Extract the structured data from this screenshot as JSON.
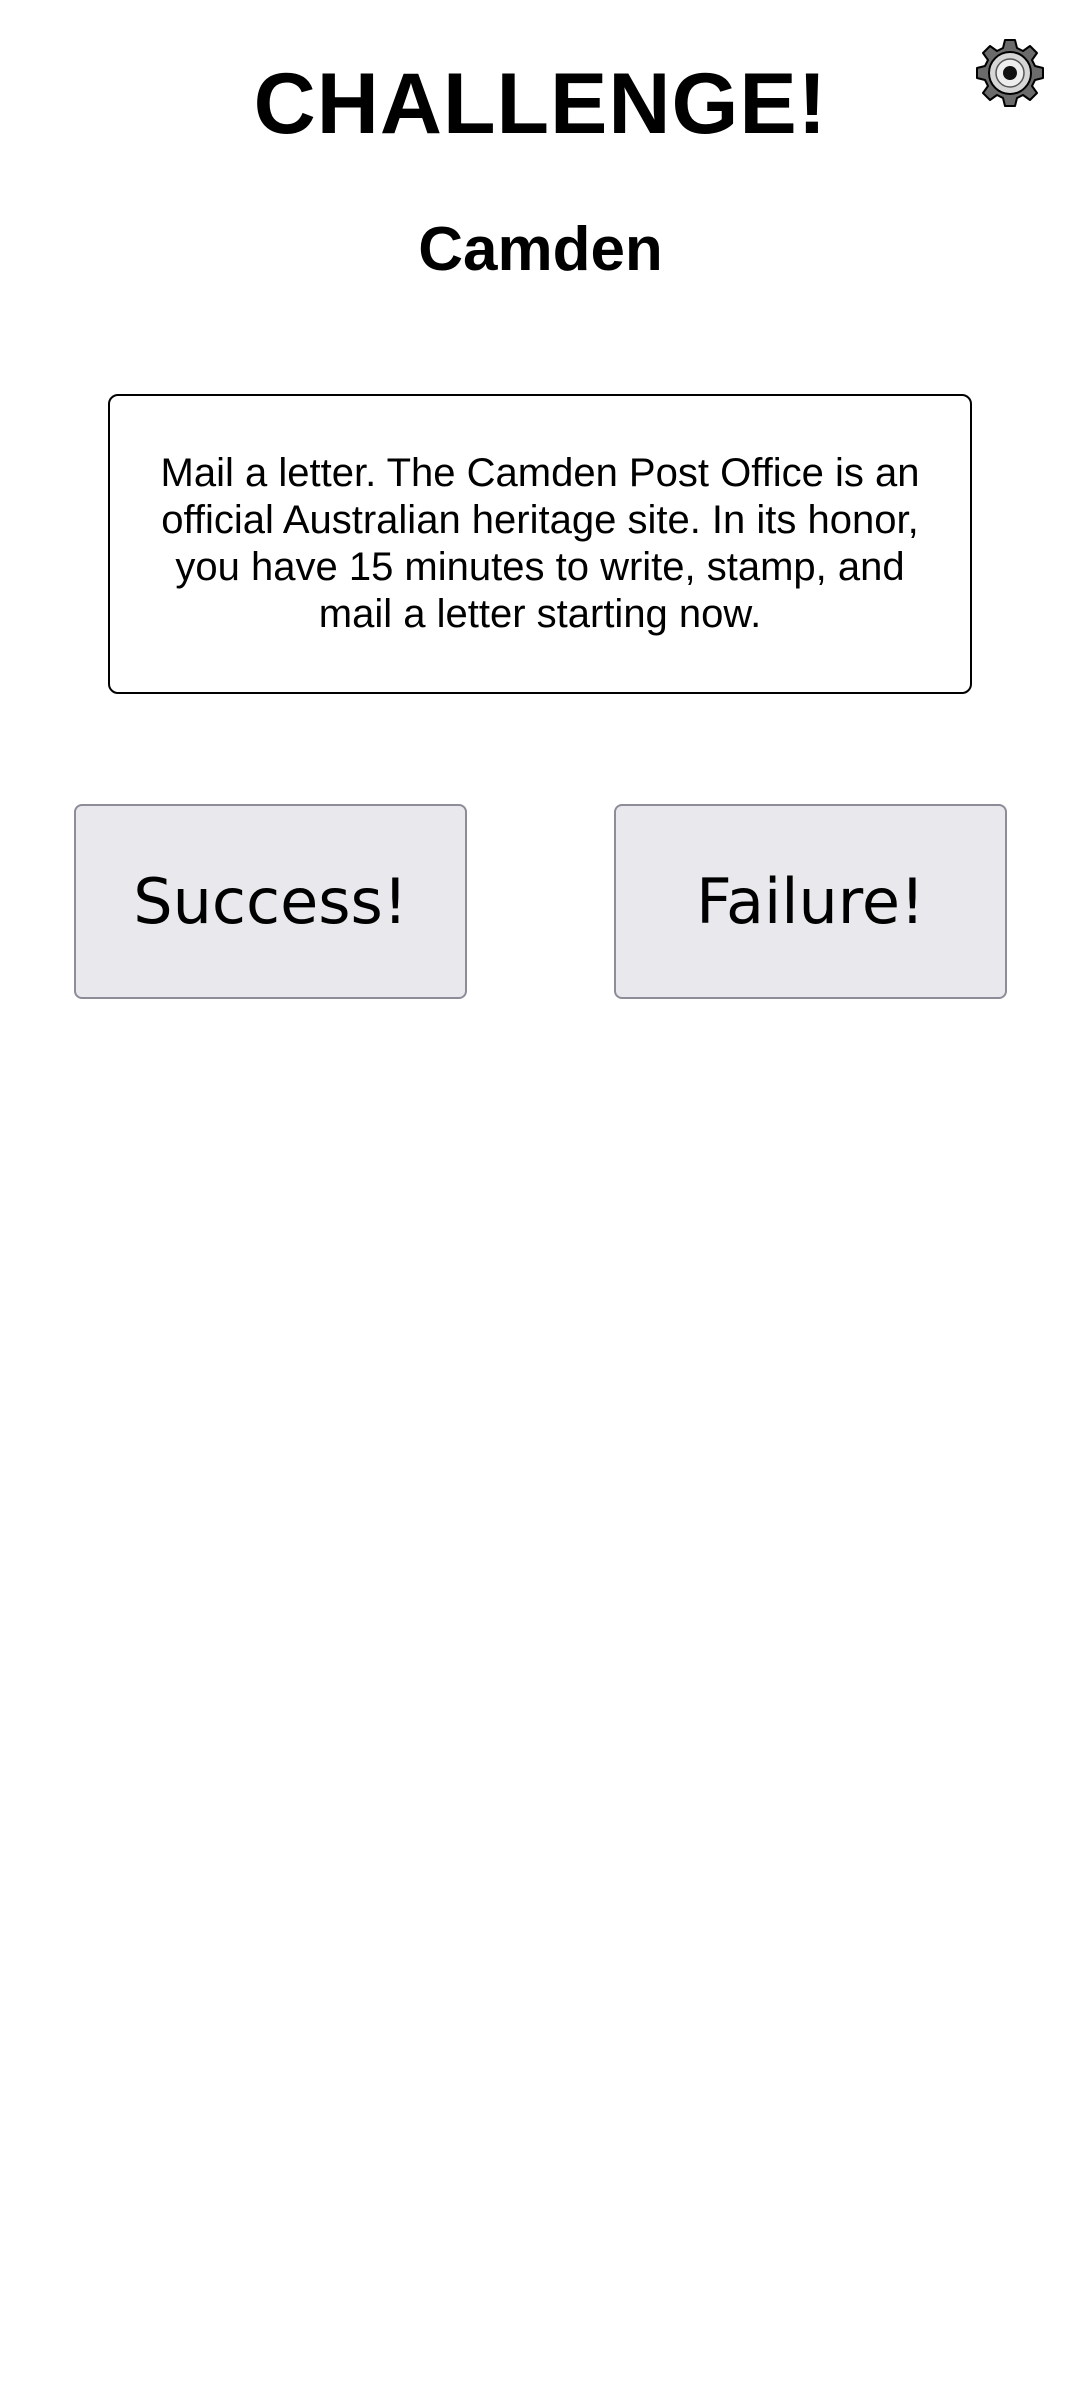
{
  "header": {
    "title": "CHALLENGE!",
    "settings_icon": "gear-icon"
  },
  "location": {
    "name": "Camden"
  },
  "challenge": {
    "text": "Mail a letter. The Camden Post Office is an official Australian heritage site. In its honor, you have 15 minutes to write, stamp, and mail a letter starting now."
  },
  "actions": {
    "success_label": "Success!",
    "failure_label": "Failure!"
  },
  "colors": {
    "button_background": "#e9e8ed",
    "button_border": "#8e8c99",
    "text": "#000000",
    "background": "#ffffff"
  }
}
